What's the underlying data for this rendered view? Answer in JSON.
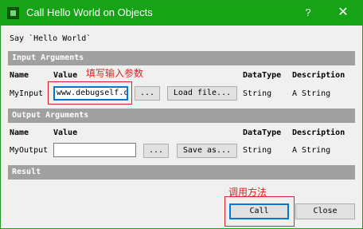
{
  "window": {
    "title": "Call Hello World on Objects",
    "help_glyph": "?",
    "close_glyph": "✕",
    "icon": "app-icon"
  },
  "description": "Say `Hello World`",
  "input_section": {
    "title": "Input Arguments",
    "headers": {
      "name": "Name",
      "value": "Value",
      "datatype": "DataType",
      "description": "Description"
    },
    "row": {
      "name": "MyInput",
      "value": "www.debugself.c",
      "browse_label": "...",
      "load_label": "Load file...",
      "datatype": "String",
      "description": "A String"
    }
  },
  "output_section": {
    "title": "Output Arguments",
    "headers": {
      "name": "Name",
      "value": "Value",
      "datatype": "DataType",
      "description": "Description"
    },
    "row": {
      "name": "MyOutput",
      "value": "",
      "browse_label": "...",
      "save_label": "Save as...",
      "datatype": "String",
      "description": "A String"
    }
  },
  "result_section": {
    "title": "Result"
  },
  "footer": {
    "call_label": "Call",
    "close_label": "Close"
  },
  "annotations": {
    "input_note": "填写输入参数",
    "call_note": "调用方法",
    "color": "#e02020"
  },
  "colors": {
    "titlebar": "#16a316",
    "section": "#a0a0a0",
    "focus": "#0078d7"
  }
}
